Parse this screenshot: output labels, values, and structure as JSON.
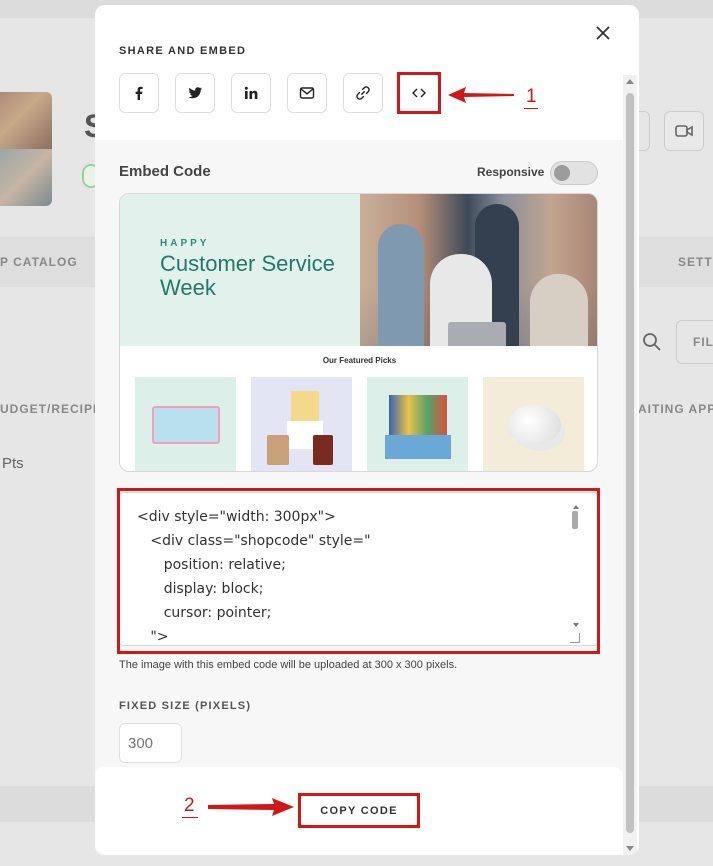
{
  "background": {
    "avatar_letter": "S",
    "tab_left": "P CATALOG",
    "tab_right": "SETT",
    "filter": "FIL",
    "col_left": "UDGET/RECIPIE",
    "col_right": "AITING APP",
    "pts": "Pts"
  },
  "modal": {
    "title": "SHARE AND EMBED",
    "share_buttons": [
      {
        "name": "facebook",
        "icon": "facebook-icon"
      },
      {
        "name": "twitter",
        "icon": "twitter-icon"
      },
      {
        "name": "linkedin",
        "icon": "linkedin-icon"
      },
      {
        "name": "email",
        "icon": "mail-icon"
      },
      {
        "name": "link",
        "icon": "link-icon"
      },
      {
        "name": "embed",
        "icon": "code-icon",
        "active": true
      }
    ],
    "embed_label": "Embed Code",
    "responsive_label": "Responsive",
    "responsive_on": false,
    "preview": {
      "banner_happy": "HAPPY",
      "banner_title": "Customer Service Week",
      "picks_title": "Our Featured Picks"
    },
    "code": "<div style=\"width: 300px\">\n   <div class=\"shopcode\" style=\"\n      position: relative;\n      display: block;\n      cursor: pointer;\n   \">",
    "note": "The image with this embed code will be uploaded at 300 x 300 pixels.",
    "fixed_size_label": "FIXED SIZE (PIXELS)",
    "fixed_size_placeholder": "300",
    "copy_label": "COPY CODE"
  },
  "annotations": {
    "callout_1": "1",
    "callout_2": "2",
    "color": "#d01818"
  }
}
